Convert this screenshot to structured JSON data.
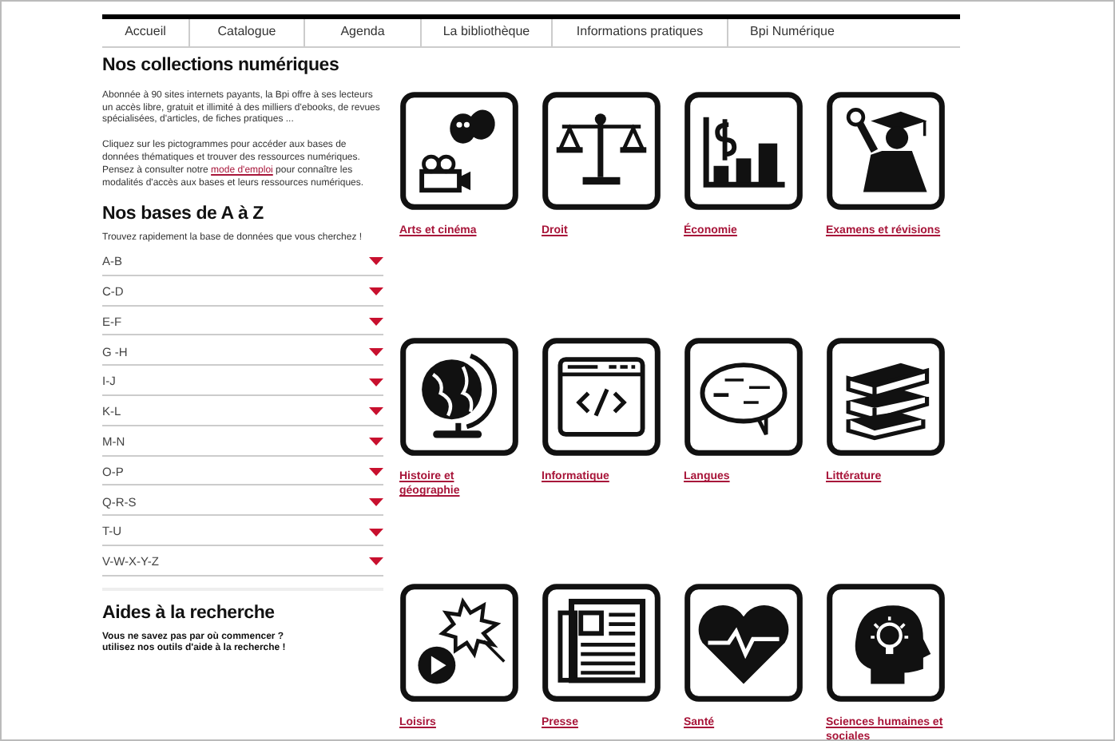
{
  "nav": [
    "Accueil",
    "Catalogue",
    "Agenda",
    "La bibliothèque",
    "Informations pratiques",
    "Bpi Numérique"
  ],
  "collections": {
    "title": "Nos collections numériques",
    "intro": "Abonnée à 90 sites internets payants, la Bpi offre à ses lecteurs un accès libre, gratuit et illimité à des milliers d'ebooks, de revues spécialisées, d'articles, de fiches pratiques ...",
    "instructions_before": "Cliquez sur les pictogrammes pour accéder aux bases de données thématiques et trouver des ressources numériques. Pensez à consulter notre",
    "link": "mode d'emploi",
    "instructions_after": "pour connaître les modalités d'accès aux bases et leurs ressources numériques."
  },
  "az": {
    "title": "Nos bases de A à Z",
    "hint": "Trouvez rapidement la base de données que vous cherchez !",
    "ranges": [
      "A-B",
      "C-D",
      "E-F",
      "G -H",
      "I-J",
      "K-L",
      "M-N",
      "O-P",
      "Q-R-S",
      "T-U",
      "V-W-X-Y-Z"
    ]
  },
  "help": {
    "title": "Aides à la recherche",
    "hint": "Vous ne savez pas par où commencer ?\nutilisez nos outils d'aide à la recherche !"
  },
  "categories": [
    "Arts et cinéma",
    "Droit",
    "Économie",
    "Examens et révisions",
    "Histoire et géographie",
    "Informatique",
    "Langues",
    "Littérature",
    "Loisirs",
    "Presse",
    "Santé",
    "Sciences humaines et sociales"
  ]
}
